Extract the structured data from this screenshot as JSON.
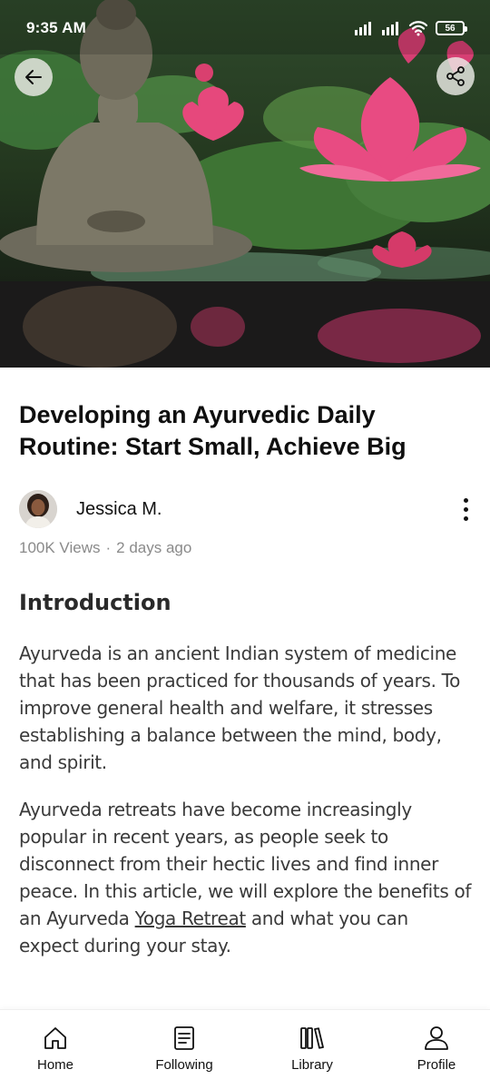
{
  "status_bar": {
    "time": "9:35 AM",
    "battery": "56"
  },
  "article": {
    "title": "Developing an Ayurvedic Daily Routine: Start Small, Achieve Big",
    "author": "Jessica M.",
    "views": "100K Views",
    "separator": "·",
    "posted": "2 days ago",
    "section_heading": "Introduction",
    "paragraph_1": "Ayurveda is an ancient Indian system of medicine that has been practiced for thousands of years. To improve general health and welfare, it stresses establishing a balance between the mind, body, and spirit.",
    "paragraph_2_before": "Ayurveda retreats have become increasingly popular in recent years, as people seek to disconnect from their hectic lives and find inner peace. In this article, we will explore the benefits of an Ayurveda ",
    "paragraph_2_link": "Yoga Retreat",
    "paragraph_2_after": " and what you can expect during your stay."
  },
  "bottom_nav": {
    "home": "Home",
    "following": "Following",
    "library": "Library",
    "profile": "Profile"
  },
  "icons": [
    "back-arrow-icon",
    "share-icon",
    "more-vertical-icon",
    "home-icon",
    "following-icon",
    "library-icon",
    "profile-icon",
    "signal-icon",
    "wifi-icon",
    "battery-icon"
  ]
}
